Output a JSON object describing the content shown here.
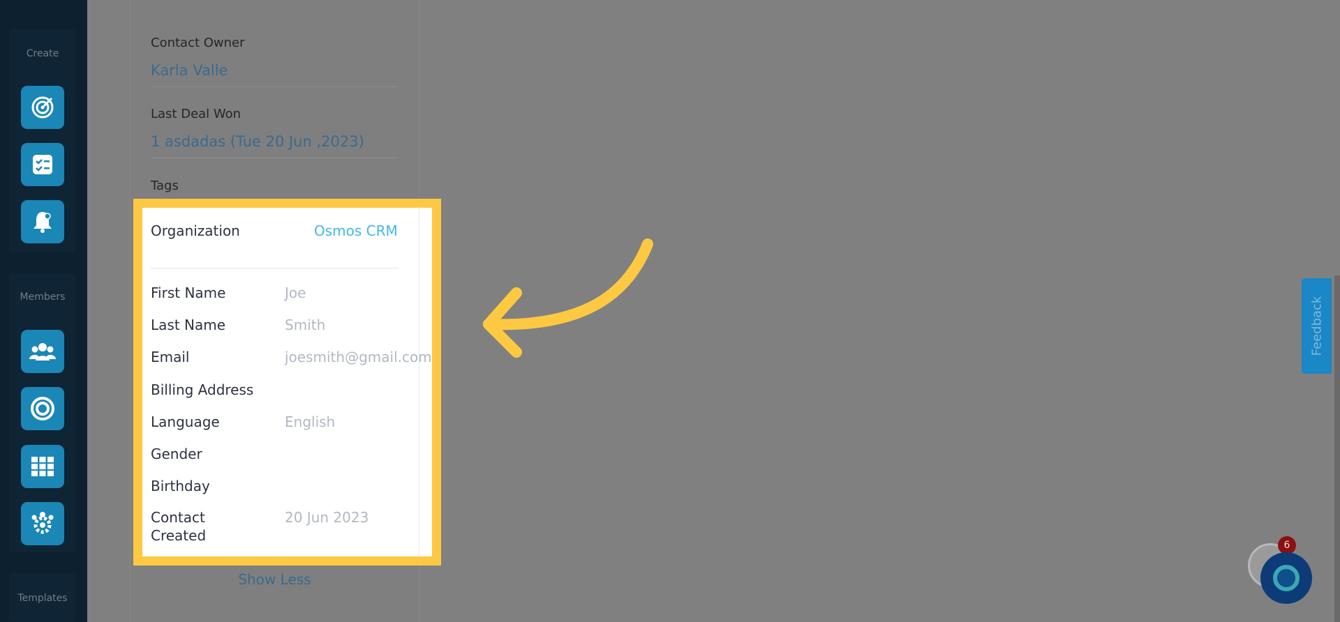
{
  "sidebar": {
    "create_label": "Create",
    "members_label": "Members",
    "templates_label": "Templates",
    "create_buttons": [
      {
        "icon": "target-icon"
      },
      {
        "icon": "checklist-icon"
      },
      {
        "icon": "bell-icon"
      }
    ],
    "member_buttons": [
      {
        "icon": "users-icon"
      },
      {
        "icon": "bullseye-icon"
      },
      {
        "icon": "grid-icon"
      },
      {
        "icon": "team-settings-icon"
      }
    ]
  },
  "contact": {
    "owner_label": "Contact Owner",
    "owner_value": "Karla Valle",
    "last_deal_label": "Last Deal Won",
    "last_deal_value": "1 asdadas (Tue 20 Jun ,2023)",
    "tags_label": "Tags",
    "organization_label": "Organization",
    "organization_value": "Osmos CRM",
    "rows": [
      {
        "label": "First Name",
        "value": "Joe"
      },
      {
        "label": "Last Name",
        "value": "Smith"
      },
      {
        "label": "Email",
        "value": "joesmith@gmail.com"
      },
      {
        "label": "Billing Address",
        "value": ""
      },
      {
        "label": "Language",
        "value": "English"
      },
      {
        "label": "Gender",
        "value": ""
      },
      {
        "label": "Birthday",
        "value": ""
      }
    ],
    "created_label_line1": "Contact",
    "created_label_line2": "Created",
    "created_value": "20 Jun 2023",
    "show_less": "Show Less"
  },
  "feedback_tab": "Feedback",
  "chat": {
    "badge_count": "6"
  },
  "colors": {
    "highlight": "#fdc942",
    "link": "#44b6ea",
    "sidebar_button": "#1a87b6"
  }
}
